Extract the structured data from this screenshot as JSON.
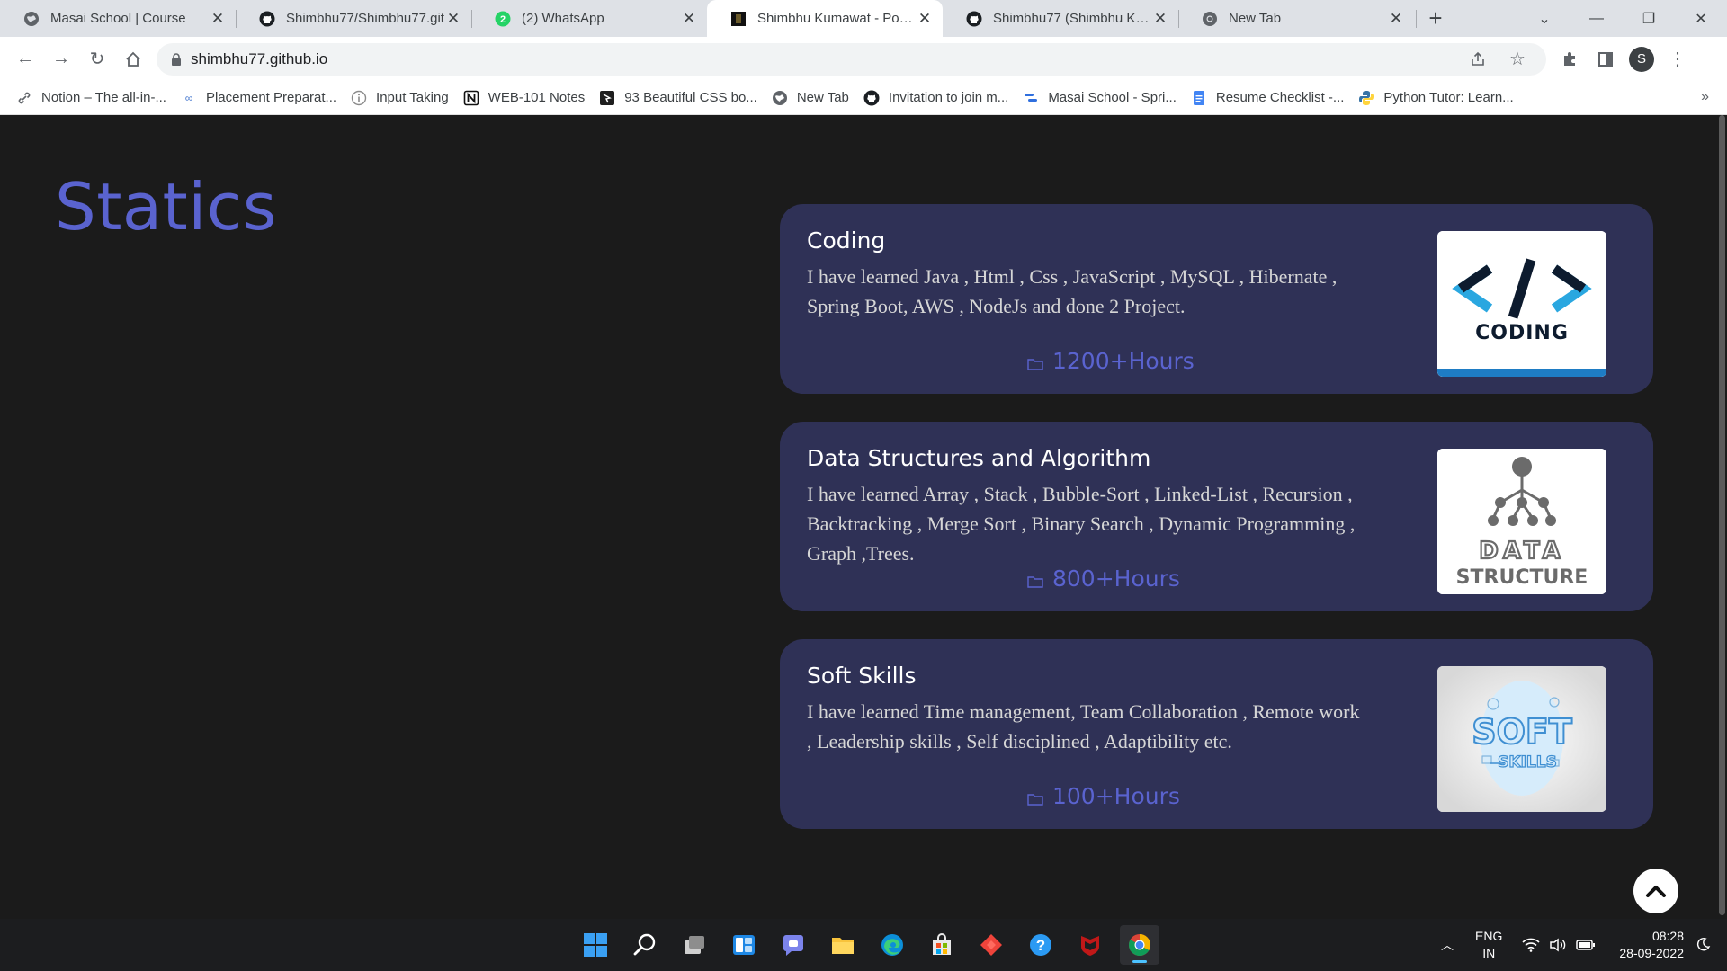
{
  "browser": {
    "tabs": [
      {
        "title": "Masai School | Course",
        "icon": "globe-icon"
      },
      {
        "title": "Shimbhu77/Shimbhu77.git",
        "icon": "github-icon"
      },
      {
        "title": "(2) WhatsApp",
        "icon": "whatsapp-icon",
        "badge": "2"
      },
      {
        "title": "Shimbhu Kumawat - Porfoli",
        "icon": "portfolio-icon",
        "active": true
      },
      {
        "title": "Shimbhu77 (Shimbhu Kuma",
        "icon": "github-icon"
      },
      {
        "title": "New Tab",
        "icon": "chrome-icon"
      }
    ],
    "url": "shimbhu77.github.io",
    "profile_initial": "S",
    "bookmarks": [
      {
        "label": "Notion – The all-in-...",
        "icon": "link-icon"
      },
      {
        "label": "Placement Preparat...",
        "icon": "infinity-icon"
      },
      {
        "label": "Input Taking",
        "icon": "info-icon"
      },
      {
        "label": "WEB-101 Notes",
        "icon": "notion-icon"
      },
      {
        "label": "93 Beautiful CSS bo...",
        "icon": "css-icon"
      },
      {
        "label": "New Tab",
        "icon": "globe-icon"
      },
      {
        "label": "Invitation to join m...",
        "icon": "github-icon"
      },
      {
        "label": "Masai School - Spri...",
        "icon": "masai-icon"
      },
      {
        "label": "Resume Checklist -...",
        "icon": "docs-icon"
      },
      {
        "label": "Python Tutor: Learn...",
        "icon": "python-icon"
      }
    ]
  },
  "page": {
    "section_title": "Statics",
    "cards": [
      {
        "title": "Coding",
        "description": "I have learned Java , Html , Css , JavaScript , MySQL , Hibernate , Spring Boot, AWS , NodeJs and done 2 Project.",
        "hours": "1200+Hours",
        "image_label": "CODING",
        "image_symbol": "</>"
      },
      {
        "title": "Data Structures and Algorithm",
        "description": "I have learned Array , Stack , Bubble-Sort , Linked-List , Recursion , Backtracking , Merge Sort , Binary Search , Dynamic Programming , Graph ,Trees.",
        "hours": "800+Hours",
        "image_label_1": "DATA",
        "image_label_2": "STRUCTURE"
      },
      {
        "title": "Soft Skills",
        "description": "I have learned Time management, Team Collaboration , Remote work , Leadership skills , Self disciplined , Adaptibility etc.",
        "hours": "100+Hours",
        "image_label_1": "SOFT",
        "image_label_2": "SKILLS"
      }
    ]
  },
  "taskbar": {
    "language_line1": "ENG",
    "language_line2": "IN",
    "time": "08:28",
    "date": "28-09-2022"
  },
  "colors": {
    "accent": "#5a63cf",
    "card_bg": "#2f3156",
    "page_bg": "#1b1b1b"
  }
}
